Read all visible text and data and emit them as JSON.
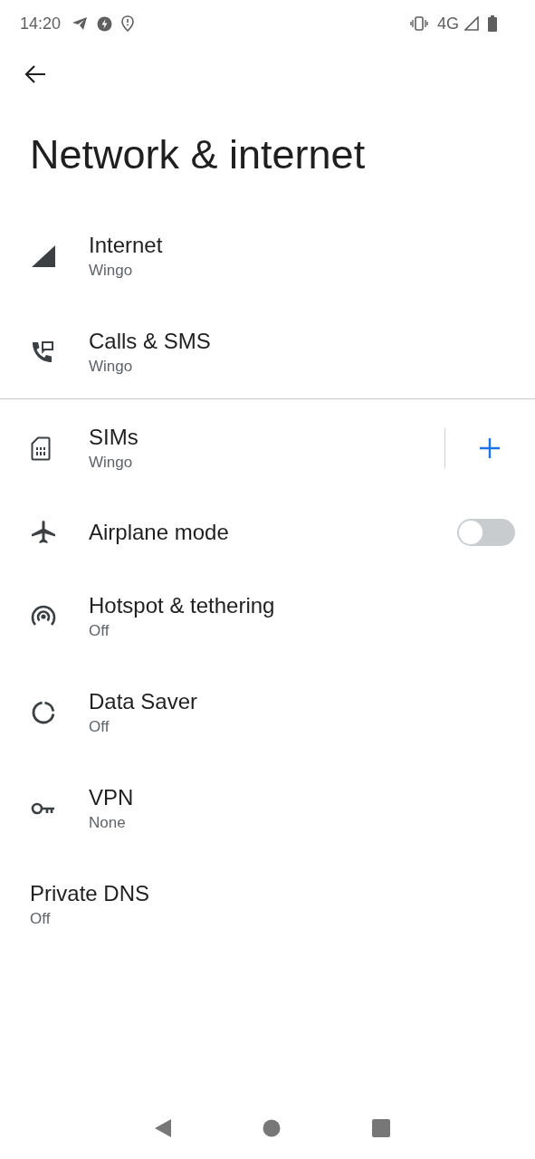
{
  "status_bar": {
    "time": "14:20",
    "network": "4G"
  },
  "title": "Network & internet",
  "items": [
    {
      "kind": "plain",
      "title": "Internet",
      "subtitle": "Wingo"
    },
    {
      "kind": "plain",
      "title": "Calls & SMS",
      "subtitle": "Wingo"
    },
    {
      "kind": "action",
      "title": "SIMs",
      "subtitle": "Wingo"
    },
    {
      "kind": "switch",
      "title": "Airplane mode",
      "on": false
    },
    {
      "kind": "plain",
      "title": "Hotspot & tethering",
      "subtitle": "Off"
    },
    {
      "kind": "plain",
      "title": "Data Saver",
      "subtitle": "Off"
    },
    {
      "kind": "plain",
      "title": "VPN",
      "subtitle": "None"
    },
    {
      "kind": "plain",
      "title": "Private DNS",
      "subtitle": "Off"
    }
  ]
}
